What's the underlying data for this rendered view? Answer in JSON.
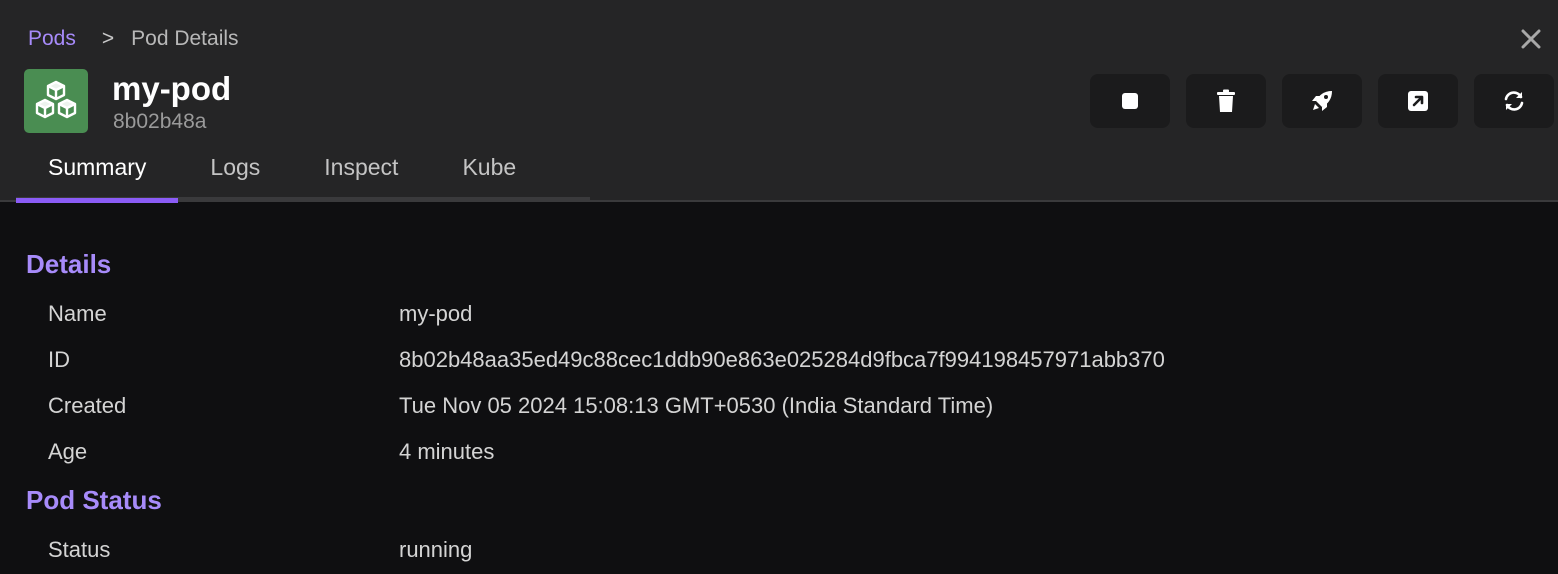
{
  "breadcrumb": {
    "parent": "Pods",
    "separator": ">",
    "current": "Pod Details"
  },
  "pod": {
    "name": "my-pod",
    "short_id": "8b02b48a",
    "icon": "pod-cubes-icon"
  },
  "actions": [
    {
      "icon": "stop-icon"
    },
    {
      "icon": "trash-icon"
    },
    {
      "icon": "rocket-icon"
    },
    {
      "icon": "external-link-icon"
    },
    {
      "icon": "restart-icon"
    }
  ],
  "tabs": [
    {
      "label": "Summary",
      "active": true
    },
    {
      "label": "Logs",
      "active": false
    },
    {
      "label": "Inspect",
      "active": false
    },
    {
      "label": "Kube",
      "active": false
    }
  ],
  "sections": {
    "details": {
      "title": "Details",
      "rows": [
        {
          "label": "Name",
          "value": "my-pod"
        },
        {
          "label": "ID",
          "value": "8b02b48aa35ed49c88cec1ddb90e863e025284d9fbca7f994198457971abb370"
        },
        {
          "label": "Created",
          "value": "Tue Nov 05 2024 15:08:13 GMT+0530 (India Standard Time)"
        },
        {
          "label": "Age",
          "value": "4 minutes"
        }
      ]
    },
    "pod_status": {
      "title": "Pod Status",
      "rows": [
        {
          "label": "Status",
          "value": "running"
        }
      ]
    }
  },
  "colors": {
    "accent": "#a78bfa",
    "tab_indicator": "#8b5cf6",
    "pod_icon_bg": "#4a8d52"
  }
}
